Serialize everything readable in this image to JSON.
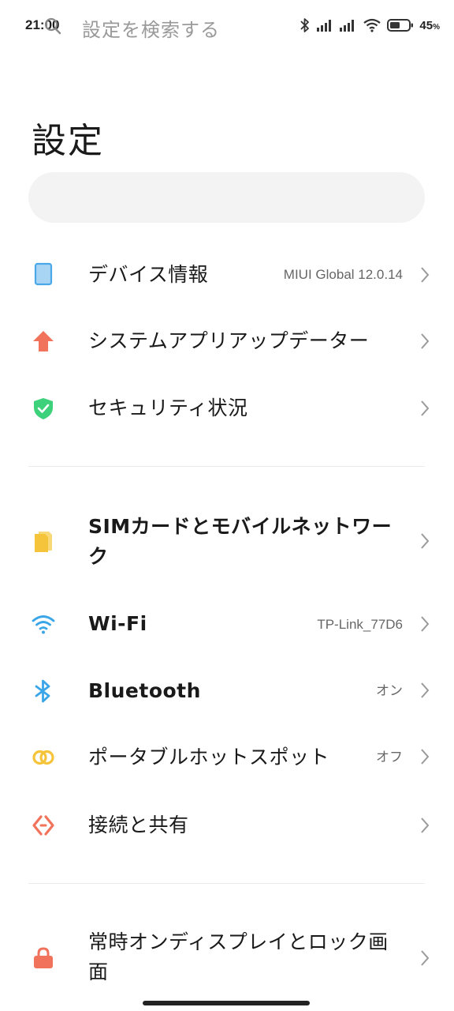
{
  "status_bar": {
    "time": "21:00",
    "battery_percent": "45",
    "battery_unit": "%",
    "icons": [
      "bluetooth-icon",
      "signal-icon",
      "signal-icon",
      "wifi-icon",
      "battery-icon"
    ]
  },
  "page": {
    "title": "設定"
  },
  "search": {
    "placeholder": "設定を検索する"
  },
  "sections": [
    {
      "items": [
        {
          "icon": "device-icon",
          "label": "デバイス情報",
          "value": "MIUI Global 12.0.14",
          "color": "#4aa8e8"
        },
        {
          "icon": "update-arrow-icon",
          "label": "システムアプリアップデーター",
          "value": "",
          "color": "#f2735b"
        },
        {
          "icon": "shield-icon",
          "label": "セキュリティ状況",
          "value": "",
          "color": "#3dd17b"
        }
      ]
    },
    {
      "items": [
        {
          "icon": "sim-card-icon",
          "label": "SIMカードとモバイルネットワーク",
          "value": "",
          "color": "#f5c43a"
        },
        {
          "icon": "wifi-icon",
          "label": "Wi-Fi",
          "value": "TP-Link_77D6",
          "color": "#3aa6e8"
        },
        {
          "icon": "bluetooth-icon",
          "label": "Bluetooth",
          "value": "オン",
          "color": "#3aa6e8"
        },
        {
          "icon": "hotspot-icon",
          "label": "ポータブルホットスポット",
          "value": "オフ",
          "color": "#f5c43a"
        },
        {
          "icon": "connection-share-icon",
          "label": "接続と共有",
          "value": "",
          "color": "#f2735b"
        }
      ]
    },
    {
      "items": [
        {
          "icon": "lock-icon",
          "label": "常時オンディスプレイとロック画面",
          "value": "",
          "color": "#f2735b"
        }
      ]
    }
  ]
}
